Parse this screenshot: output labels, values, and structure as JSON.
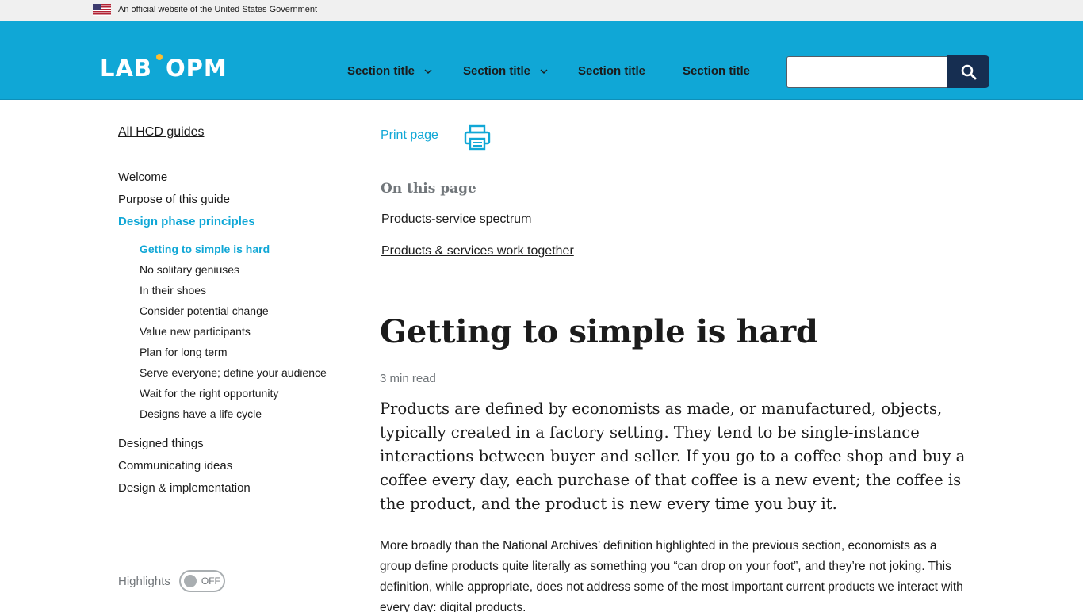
{
  "gov_banner": {
    "text": "An official website of the United States Government"
  },
  "header": {
    "logo_left": "LAB",
    "logo_right": "OPM",
    "nav": [
      {
        "label": "Section title",
        "has_dropdown": true
      },
      {
        "label": "Section title",
        "has_dropdown": true
      },
      {
        "label": "Section title",
        "has_dropdown": false
      },
      {
        "label": "Section title",
        "has_dropdown": false
      }
    ],
    "search": {
      "value": "",
      "placeholder": "",
      "button_icon": "search-icon"
    }
  },
  "sidebar": {
    "all_guides": "All HCD guides",
    "items": [
      {
        "label": "Welcome"
      },
      {
        "label": "Purpose of this guide"
      },
      {
        "label": "Design phase principles",
        "active": true
      }
    ],
    "sub_items": [
      {
        "label": "Getting to simple is hard",
        "active": true
      },
      {
        "label": "No solitary geniuses"
      },
      {
        "label": "In their shoes"
      },
      {
        "label": "Consider potential change"
      },
      {
        "label": "Value new participants"
      },
      {
        "label": "Plan for long term"
      },
      {
        "label": "Serve everyone; define your audience"
      },
      {
        "label": "Wait for the right opportunity"
      },
      {
        "label": "Designs have a life cycle"
      }
    ],
    "after_items": [
      {
        "label": "Designed things"
      },
      {
        "label": "Communicating ideas"
      },
      {
        "label": "Design & implementation"
      }
    ],
    "highlights": {
      "label": "Highlights",
      "toggle_state": "OFF"
    }
  },
  "main": {
    "print_label": "Print page",
    "on_this_page": "On this page",
    "toc": [
      "Products-service spectrum",
      "Products & services work together"
    ],
    "title": "Getting to simple is hard",
    "read_time": "3 min read",
    "lead": "Products are defined by economists as made, or manufactured, objects, typically created in a factory setting. They tend to be single-instance interactions between buyer and seller. If you go to a coffee shop and buy a coffee every day, each purchase of that coffee is a new event; the coffee is the product, and the product is new every time you buy it.",
    "body": "More broadly than the National Archives’ definition highlighted in the previous section, economists as a group define products quite literally as something you “can drop on your foot”, and they’re not joking. This definition, while appropriate, does not address some of the most important current products we interact with every day: digital products."
  },
  "colors": {
    "header_bg": "#10a7d6",
    "accent": "#10a7d6",
    "search_button": "#162e51",
    "banner_bg": "#f0f0f0"
  }
}
